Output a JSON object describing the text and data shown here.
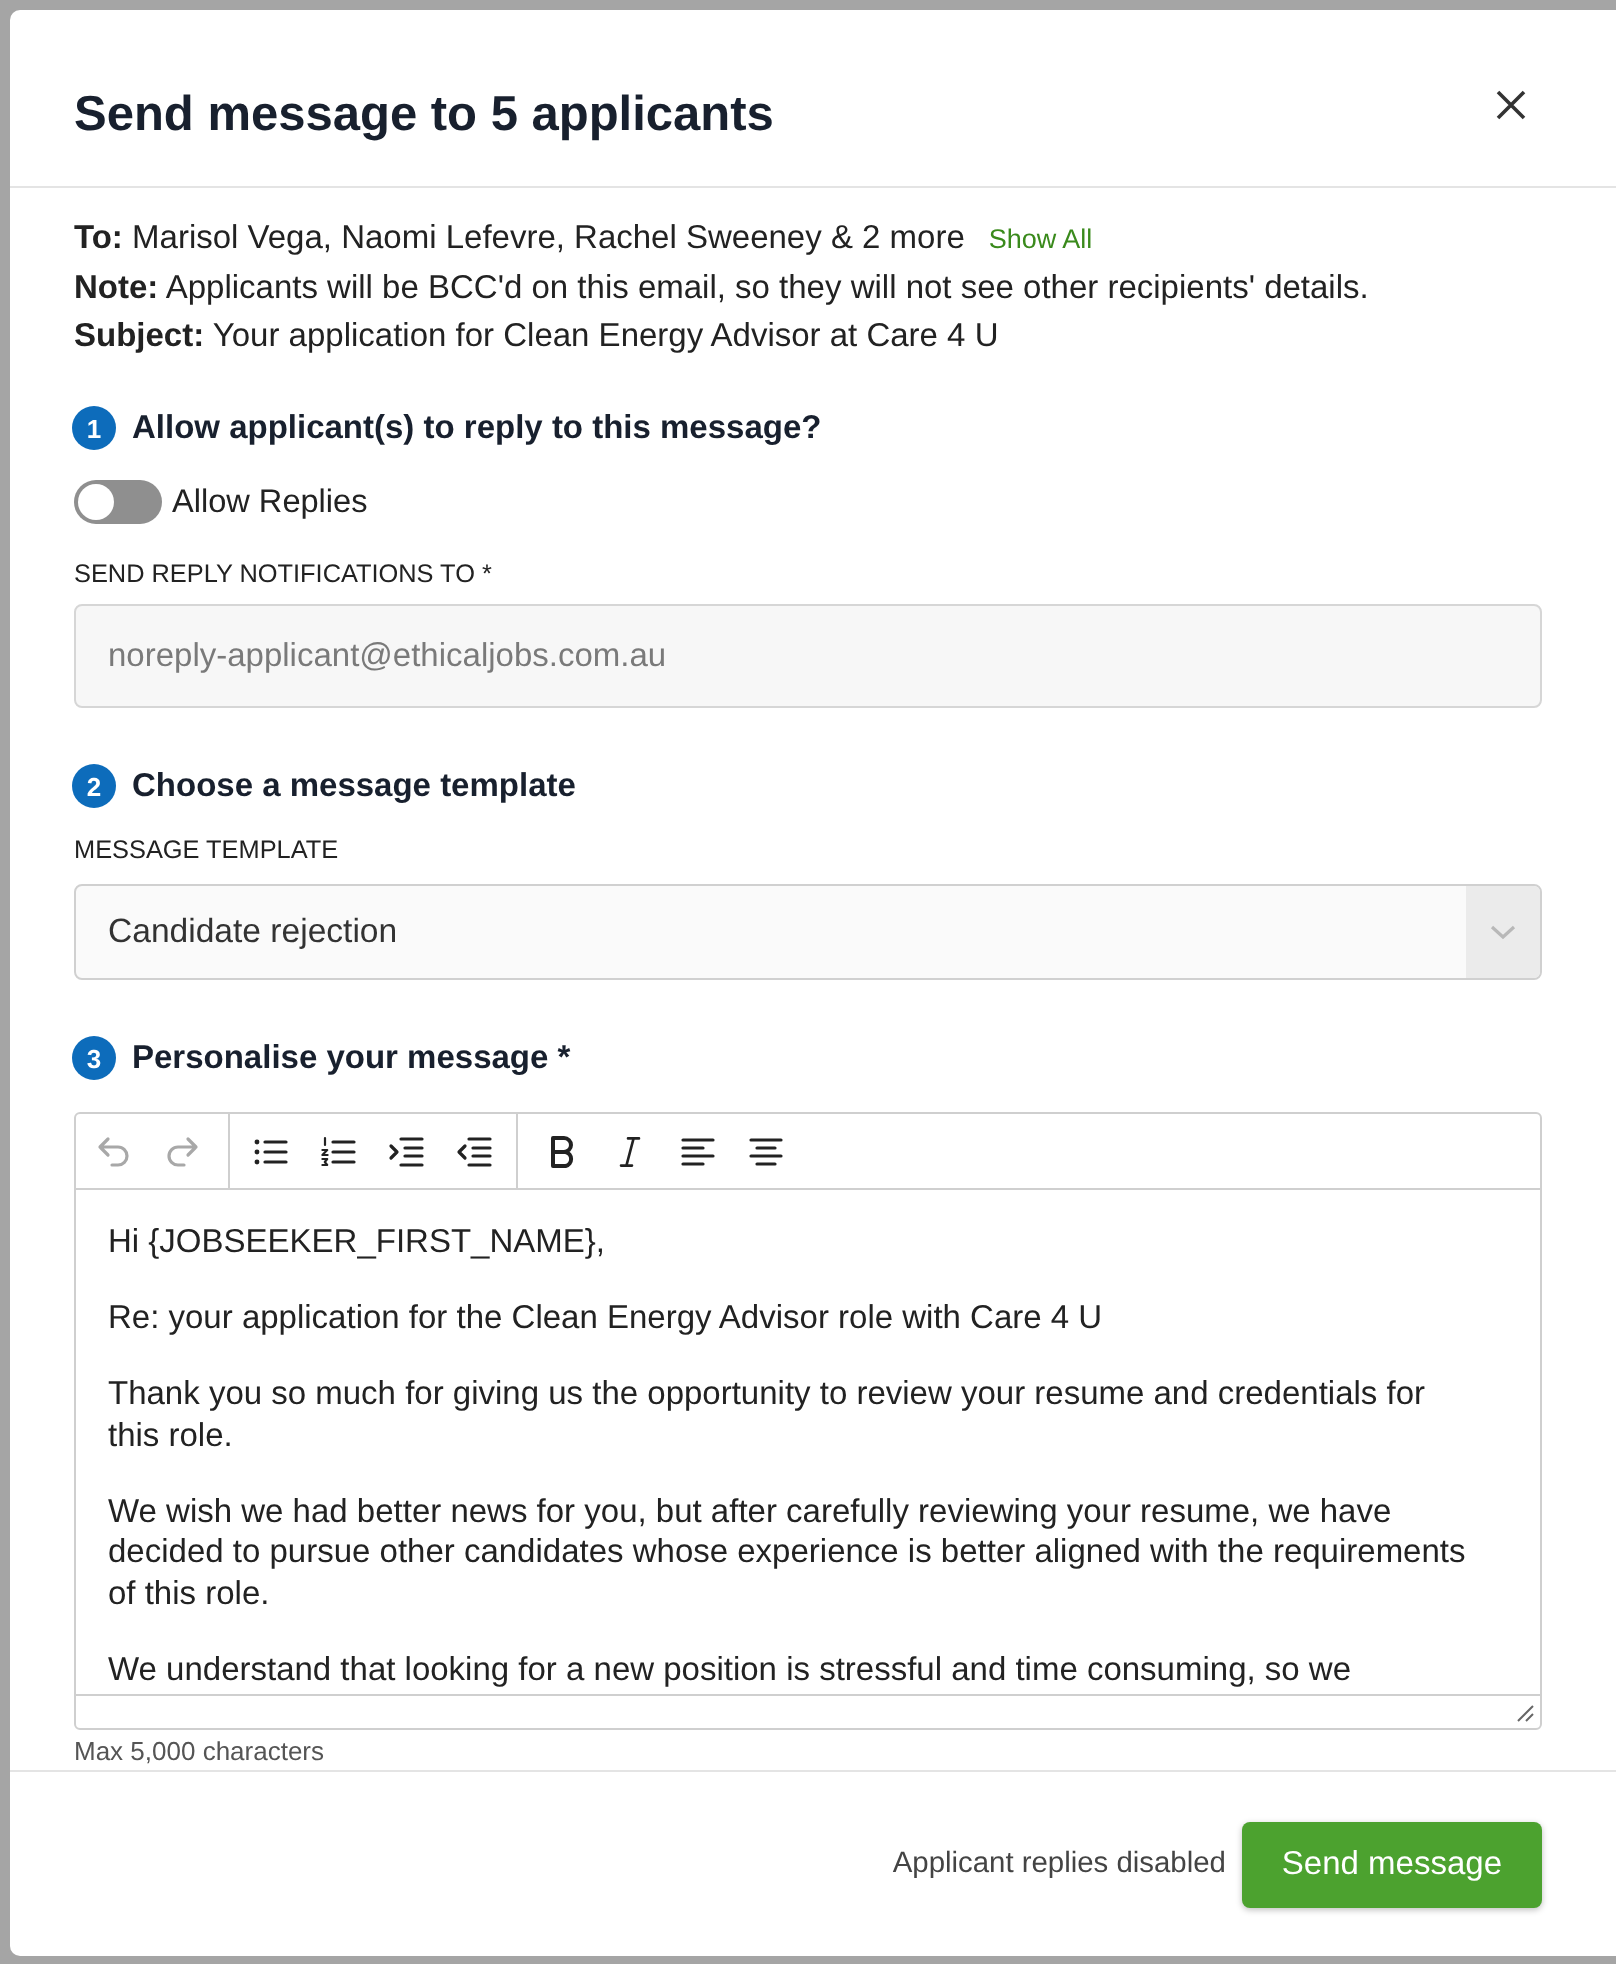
{
  "dialog": {
    "title": "Send message to 5 applicants"
  },
  "summary": [
    {
      "text": "**To:** Marisol Vega, Naomi Lefevre, Rachel Sweeney & 2 more",
      "link": "Show All"
    },
    {
      "text": "**Note:** Applicants will be BCC'd on this email, so they will not see other recipients' details."
    },
    {
      "text": "**Subject:** Your application for Clean Energy Advisor at Care 4 U"
    }
  ],
  "reply_section": {
    "number": "1",
    "heading": "Allow applicant(s) to reply to this message?",
    "toggle": {
      "label": "Allow Replies",
      "on": false
    },
    "field": {
      "label": "SEND REPLY NOTIFICATIONS TO *",
      "value": "noreply-applicant@ethicaljobs.com.au",
      "disabled": true
    }
  },
  "template_section": {
    "number": "2",
    "heading": "Choose a message template",
    "field": {
      "label": "MESSAGE TEMPLATE",
      "value": "Candidate rejection"
    }
  },
  "message_section": {
    "number": "3",
    "heading": "Personalise your message *",
    "toolbar": [
      {
        "buttons": [
          {
            "kind": "undo",
            "disabled": true
          },
          {
            "kind": "redo",
            "disabled": true
          }
        ]
      },
      {
        "buttons": [
          {
            "kind": "bullets",
            "disabled": false
          },
          {
            "kind": "numbers",
            "disabled": false
          },
          {
            "kind": "indent",
            "disabled": false
          },
          {
            "kind": "outdent",
            "disabled": false
          }
        ]
      },
      {
        "buttons": [
          {
            "kind": "bold",
            "disabled": false
          },
          {
            "kind": "italic",
            "disabled": false
          },
          {
            "kind": "alignleft",
            "disabled": false
          },
          {
            "kind": "aligncenter",
            "disabled": false
          }
        ]
      }
    ],
    "body": [
      "Hi {JOBSEEKER_FIRST_NAME},",
      "Re: your application for the Clean Energy Advisor role with Care 4 U",
      "Thank you so much for giving us the opportunity to review your resume and credentials for this role.",
      "We wish we had better news for you, but after carefully reviewing your resume, we have decided to pursue other candidates whose experience is better aligned with the requirements of this role.",
      "We understand that looking for a new position is stressful and time consuming, so we"
    ],
    "hint": "Max 5,000 characters"
  },
  "footer": {
    "status": "Applicant replies disabled",
    "button": "Send message"
  }
}
